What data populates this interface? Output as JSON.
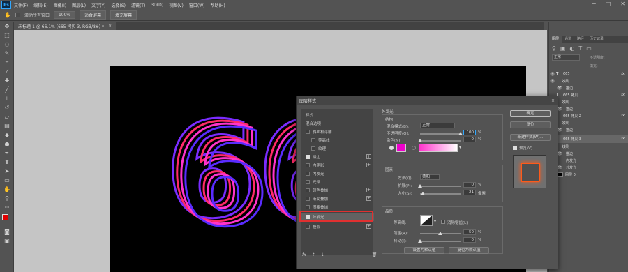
{
  "app": {
    "logo": "Ps"
  },
  "menu": [
    "文件(F)",
    "编辑(E)",
    "图像(I)",
    "图层(L)",
    "文字(Y)",
    "选择(S)",
    "滤镜(T)",
    "3D(D)",
    "视图(V)",
    "窗口(W)",
    "帮助(H)"
  ],
  "options": {
    "scroll_all": "滚动所有窗口",
    "zoom": "100%",
    "fit_screen": "适合屏幕",
    "fill_screen": "填充屏幕"
  },
  "doc_tab": {
    "title": "未标题-1 @ 66.1% (665 拷贝 3, RGB/8#) *",
    "close": "×"
  },
  "canvas_text": "66",
  "colors": {
    "accent_red": "#e03030",
    "pink": "#ff33cc",
    "magenta_swatch": "#ee00cc",
    "glow_orange": "#ff5a1a"
  },
  "layers_panel": {
    "tabs": [
      "图层",
      "通道",
      "路径",
      "历史记录"
    ],
    "mode": "正常",
    "opacity_label": "不透明度:",
    "fill_label": "填充:",
    "rows": [
      {
        "name": "665",
        "type": "text",
        "fx": "fx"
      },
      {
        "name": "效果",
        "type": "effects"
      },
      {
        "name": "描边",
        "type": "effect"
      },
      {
        "name": "665 拷贝",
        "type": "text",
        "fx": "fx"
      },
      {
        "name": "效果",
        "type": "effects"
      },
      {
        "name": "描边",
        "type": "effect"
      },
      {
        "name": "665 拷贝 2",
        "type": "text",
        "fx": "fx"
      },
      {
        "name": "效果",
        "type": "effects"
      },
      {
        "name": "描边",
        "type": "effect"
      },
      {
        "name": "665 拷贝 3",
        "type": "text",
        "fx": "fx",
        "selected": true
      },
      {
        "name": "效果",
        "type": "effects"
      },
      {
        "name": "描边",
        "type": "effect"
      },
      {
        "name": "内发光",
        "type": "effect"
      },
      {
        "name": "外发光",
        "type": "effect"
      },
      {
        "name": "图层 0",
        "type": "layer"
      }
    ]
  },
  "dialog": {
    "title": "图层样式",
    "close": "×",
    "styles_header": "样式",
    "blend_options": "混合选项",
    "style_items": [
      {
        "label": "斜面和浮雕",
        "checked": false,
        "plus": false
      },
      {
        "label": "等高线",
        "checked": false,
        "plus": false,
        "indent": true
      },
      {
        "label": "纹理",
        "checked": false,
        "plus": false,
        "indent": true
      },
      {
        "label": "描边",
        "checked": true,
        "plus": true
      },
      {
        "label": "内阴影",
        "checked": false,
        "plus": true
      },
      {
        "label": "内发光",
        "checked": false,
        "plus": false
      },
      {
        "label": "光泽",
        "checked": false,
        "plus": false
      },
      {
        "label": "颜色叠加",
        "checked": false,
        "plus": true
      },
      {
        "label": "渐变叠加",
        "checked": false,
        "plus": true
      },
      {
        "label": "图案叠加",
        "checked": false,
        "plus": false
      },
      {
        "label": "外发光",
        "checked": true,
        "plus": false,
        "selected": true
      },
      {
        "label": "投影",
        "checked": false,
        "plus": true
      }
    ],
    "footer": {
      "fx": "fx",
      "up": "⇡",
      "down": "⇣",
      "trash": "🗑"
    },
    "outer_glow": {
      "header": "外发光",
      "structure": "结构",
      "blend_mode_label": "混合模式(B):",
      "blend_mode": "正常",
      "opacity_label": "不透明度(O):",
      "opacity": "100",
      "noise_label": "杂色(N):",
      "noise": "0",
      "percent": "%",
      "pixel": "像素",
      "elements": "图素",
      "method_label": "方法(Q):",
      "method": "柔和",
      "spread_label": "扩展(P):",
      "spread": "0",
      "size_label": "大小(S):",
      "size": "21",
      "quality": "品质",
      "contour_label": "等高线:",
      "antialias": "消除锯齿(L)",
      "range_label": "范围(R):",
      "range": "50",
      "jitter_label": "抖动(J):",
      "jitter": "0",
      "set_default": "设置为默认值",
      "reset_default": "复位为默认值"
    },
    "buttons": {
      "ok": "确定",
      "reset": "复位",
      "new_style": "新建样式(W)...",
      "preview": "预览(V)"
    }
  }
}
